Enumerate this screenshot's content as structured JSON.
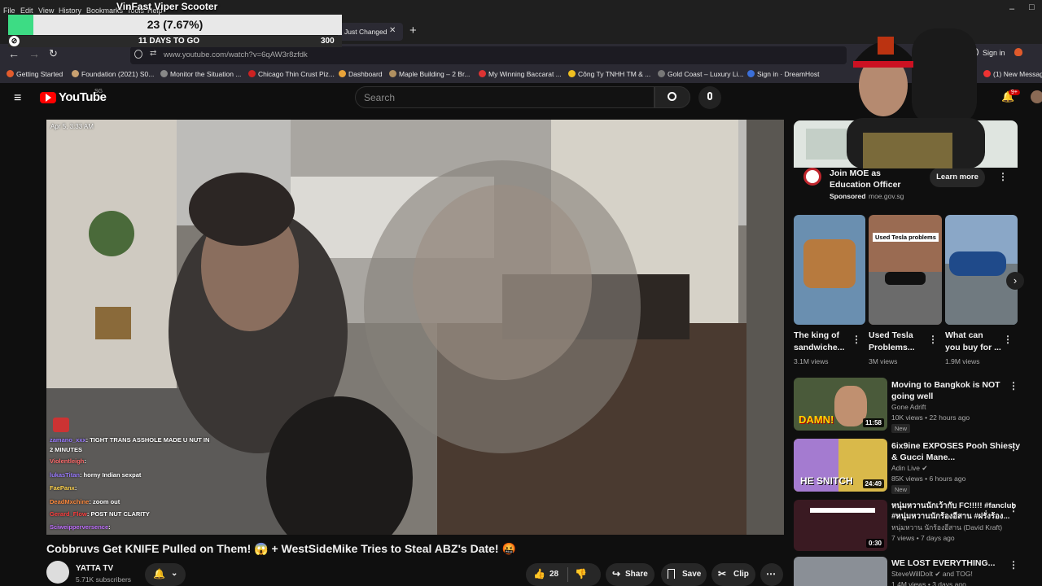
{
  "browser": {
    "menu": [
      "File",
      "Edit",
      "View",
      "History",
      "Bookmarks",
      "Tools",
      "Help"
    ],
    "tab_title": "Just Changed",
    "url": "www.youtube.com/watch?v=6qAW3r8zfdk",
    "sign_in": "Sign in",
    "new_message": "(1) New Messag",
    "bookmarks": [
      {
        "label": "Getting Started",
        "color": "#e25b2c"
      },
      {
        "label": "Foundation (2021) S0...",
        "color": "#c8a070"
      },
      {
        "label": "Monitor the Situation ...",
        "color": "#888"
      },
      {
        "label": "Chicago Thin Crust Piz...",
        "color": "#c22"
      },
      {
        "label": "Dashboard",
        "color": "#e8a33a"
      },
      {
        "label": "Maple Building – 2 Br...",
        "color": "#b09060"
      },
      {
        "label": "My Winning Baccarat ...",
        "color": "#d33"
      },
      {
        "label": "Công Ty TNHH TM & ...",
        "color": "#f0c020"
      },
      {
        "label": "Gold Coast – Luxury Li...",
        "color": "#777"
      },
      {
        "label": "Sign in · DreamHost",
        "color": "#3b6fd9"
      }
    ]
  },
  "stream_overlay": {
    "goal_title": "VinFast Viper Scooter",
    "goal_progress": "23 (7.67%)",
    "goal_fraction": 0.0767,
    "days": "11 DAYS TO GO",
    "goal_target": "300"
  },
  "youtube": {
    "logo": "YouTube",
    "region": "SG",
    "search_placeholder": "Search",
    "notification_count": "9+",
    "video": {
      "timestamp": "Apr 5, 3:33 AM",
      "title": "Cobbruvs Get KNIFE Pulled on Them! 😱 + WestSideMike Tries to Steal ABZ's Date! 🤬",
      "channel": "YATTA TV",
      "subscribers": "5.71K subscribers",
      "likes": "28",
      "share": "Share",
      "save": "Save",
      "clip": "Clip"
    },
    "chat": [
      {
        "user": "zamano_xxx",
        "text": ": TIGHT TRANS ASSHOLE MADE U NUT IN"
      },
      {
        "user": "",
        "text": "2 MINUTES"
      },
      {
        "user": "Violentleigh",
        "text": ":"
      },
      {
        "user": "lukasTitan",
        "text": ": horny Indian sexpat"
      },
      {
        "user": "FaePanx",
        "text": ":"
      },
      {
        "user": "DeadMxchine",
        "text": ": zoom out"
      },
      {
        "user": "Gerard_Flow",
        "text": ": POST NUT CLARITY"
      },
      {
        "user": "Sciweipperversence",
        "text": ":"
      }
    ],
    "ad": {
      "title1": "Join MOE as",
      "title2": "Education Officer",
      "sponsored": "Sponsored",
      "domain": "moe.gov.sg",
      "cta": "Learn more"
    },
    "shorts": [
      {
        "title1": "The king of",
        "title2": "sandwiche...",
        "views": "3.1M views",
        "overlay": ""
      },
      {
        "title1": "Used Tesla",
        "title2": "Problems...",
        "views": "3M views",
        "overlay": "Used Tesla problems"
      },
      {
        "title1": "What can",
        "title2": "you buy for ...",
        "views": "1.9M views",
        "overlay": ""
      }
    ],
    "recommended": [
      {
        "title1": "Moving to Bangkok is NOT",
        "title2": "going well",
        "channel": "Gone Adrift",
        "meta": "10K views • 22 hours ago",
        "badge": "New",
        "duration": "11:58",
        "thumb_text": "DAMN!"
      },
      {
        "title1": "6ix9ine EXPOSES Pooh Shiesty",
        "title2": "& Gucci Mane...",
        "channel": "Adin Live ✔",
        "meta": "85K views • 6 hours ago",
        "badge": "New",
        "duration": "24:49",
        "thumb_text": "HE SNITCH"
      },
      {
        "title1": "หนุ่มหวานนักเว้ากับ FC!!!!! #fanclub",
        "title2": "#หนุ่มหวานนักร้องอีสาน #ฝรั่งร้อง...",
        "channel": "หนุ่มหวาน นักร้องอีสาน (David Kraft)",
        "meta": "7 views • 7 days ago",
        "badge": "",
        "duration": "0:30",
        "thumb_text": ""
      },
      {
        "title1": "WE LOST EVERYTHING...",
        "title2": "",
        "channel": "SteveWillDoIt ✔ and TOG!",
        "meta": "1.4M views • 3 days ago",
        "badge": "",
        "duration": "",
        "thumb_text": ""
      }
    ]
  }
}
